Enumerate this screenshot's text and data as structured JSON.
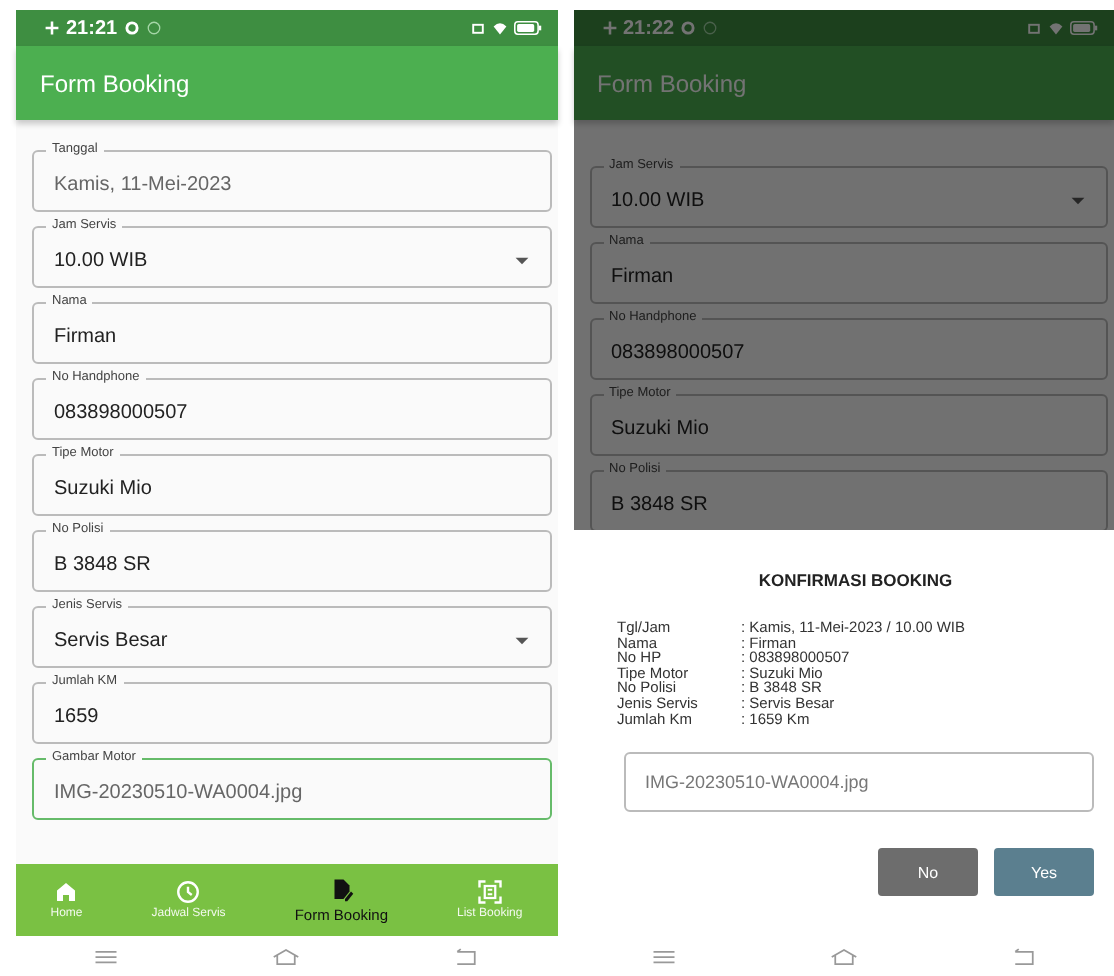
{
  "left_screen": {
    "status_time": "21:21",
    "app_title": "Form Booking",
    "fields": [
      {
        "label": "Tanggal",
        "value": "Kamis, 11-Mei-2023",
        "kind": "date",
        "focused": false
      },
      {
        "label": "Jam Servis",
        "value": "10.00 WIB",
        "kind": "dropdown",
        "focused": false
      },
      {
        "label": "Nama",
        "value": "Firman",
        "kind": "text",
        "focused": false
      },
      {
        "label": "No Handphone",
        "value": "083898000507",
        "kind": "text",
        "focused": false
      },
      {
        "label": "Tipe Motor",
        "value": "Suzuki Mio",
        "kind": "text",
        "focused": false
      },
      {
        "label": "No Polisi",
        "value": "B 3848 SR",
        "kind": "text",
        "focused": false
      },
      {
        "label": "Jenis Servis",
        "value": "Servis Besar",
        "kind": "dropdown",
        "focused": false
      },
      {
        "label": "Jumlah KM",
        "value": "1659",
        "kind": "text",
        "focused": false
      },
      {
        "label": "Gambar Motor",
        "value": "IMG-20230510-WA0004.jpg",
        "kind": "date",
        "focused": true
      }
    ],
    "nav": [
      {
        "label": "Home",
        "kind": "home",
        "selected": false
      },
      {
        "label": "Jadwal Servis",
        "kind": "schedule",
        "selected": false
      },
      {
        "label": "Form Booking",
        "kind": "form",
        "selected": true
      },
      {
        "label": "List Booking",
        "kind": "list",
        "selected": false
      }
    ]
  },
  "right_screen": {
    "status_time": "21:22",
    "app_title": "Form Booking",
    "fields": [
      {
        "label": "Jam Servis",
        "value": "10.00 WIB",
        "kind": "dropdown"
      },
      {
        "label": "Nama",
        "value": "Firman",
        "kind": "text"
      },
      {
        "label": "No Handphone",
        "value": "083898000507",
        "kind": "text"
      },
      {
        "label": "Tipe Motor",
        "value": "Suzuki Mio",
        "kind": "text"
      },
      {
        "label": "No Polisi",
        "value": "B 3848 SR",
        "kind": "text"
      }
    ],
    "dialog": {
      "title": "KONFIRMASI BOOKING",
      "rows": [
        {
          "label": "Tgl/Jam",
          "value": ": Kamis, 11-Mei-2023 / 10.00 WIB"
        },
        {
          "label": "Nama",
          "value": ": Firman"
        },
        {
          "label": "No HP",
          "value": ": 083898000507"
        },
        {
          "label": "Tipe Motor",
          "value": ": Suzuki Mio"
        },
        {
          "label": "No Polisi",
          "value": ": B 3848 SR"
        },
        {
          "label": "Jenis Servis",
          "value": ": Servis Besar"
        },
        {
          "label": "Jumlah Km",
          "value": ": 1659 Km"
        }
      ],
      "file_value": "IMG-20230510-WA0004.jpg",
      "buttons": [
        {
          "label": "No",
          "kind": "cancel"
        },
        {
          "label": "Yes",
          "kind": "confirm"
        }
      ]
    }
  }
}
